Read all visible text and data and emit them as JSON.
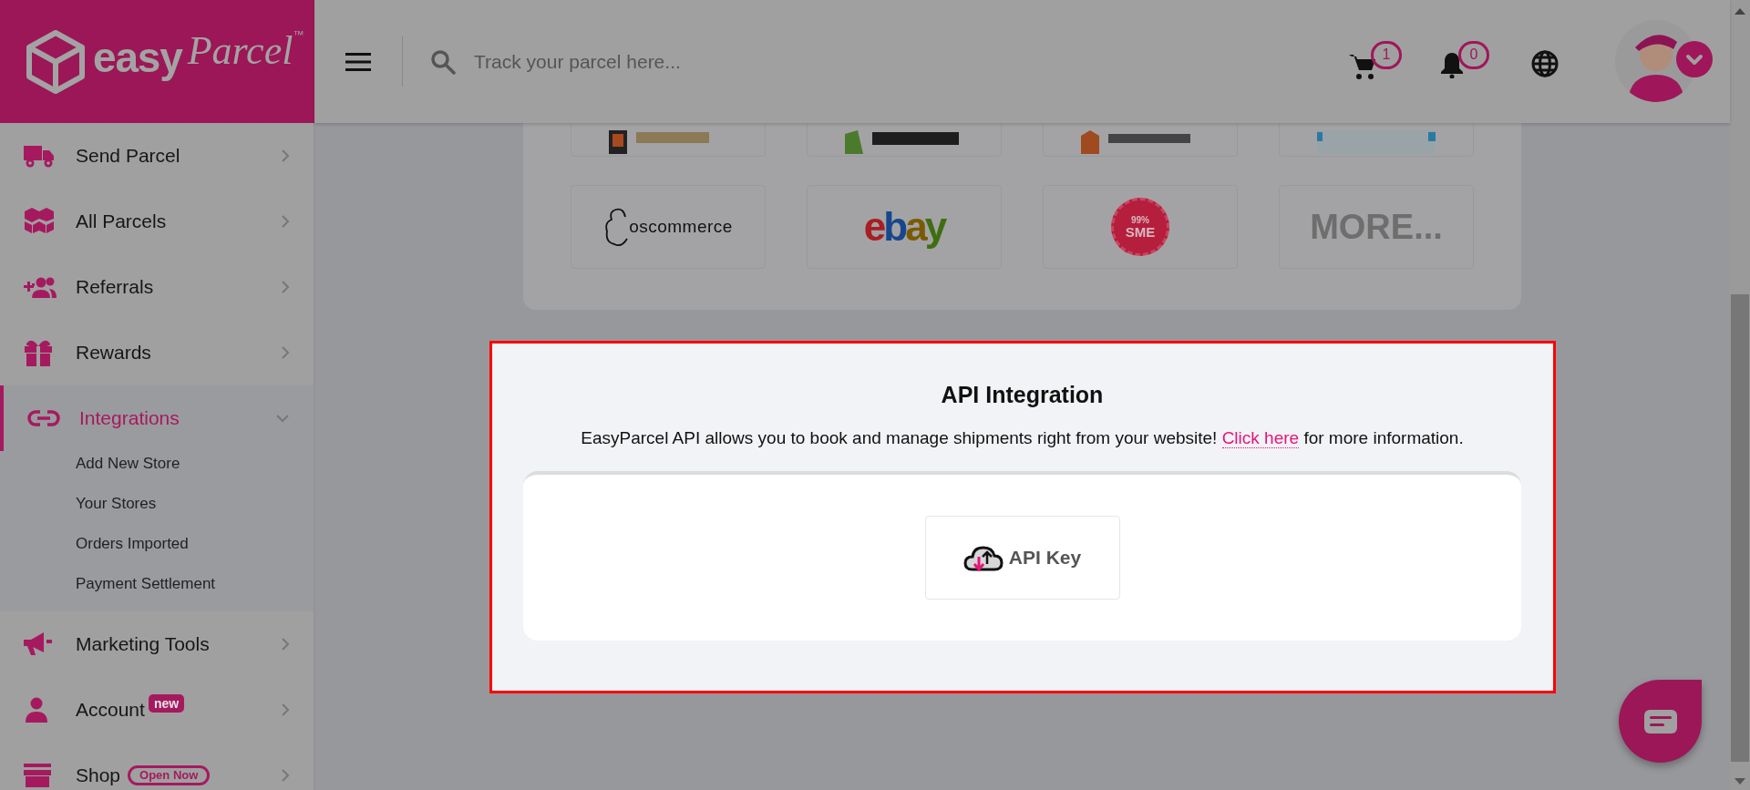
{
  "brand": {
    "name_bold": "easy",
    "name_script": "Parcel",
    "mark": "™"
  },
  "header": {
    "search": {
      "placeholder": "Track your parcel here..."
    },
    "cart_count": "1",
    "notification_count": "0"
  },
  "sidebar": {
    "items": [
      {
        "label": "Send Parcel",
        "selected": false,
        "expanded": false
      },
      {
        "label": "All Parcels",
        "selected": false,
        "expanded": false
      },
      {
        "label": "Referrals",
        "selected": false,
        "expanded": false
      },
      {
        "label": "Rewards",
        "selected": false,
        "expanded": false
      },
      {
        "label": "Integrations",
        "selected": true,
        "expanded": true,
        "children": [
          {
            "label": "Add New Store"
          },
          {
            "label": "Your Stores"
          },
          {
            "label": "Orders Imported"
          },
          {
            "label": "Payment Settlement"
          }
        ]
      },
      {
        "label": "Marketing Tools",
        "selected": false,
        "expanded": false
      },
      {
        "label": "Account",
        "selected": false,
        "expanded": false,
        "badge": {
          "text": "new",
          "kind": "filled"
        }
      },
      {
        "label": "Shop",
        "selected": false,
        "expanded": false,
        "badge": {
          "text": "Open Now",
          "kind": "outline"
        }
      }
    ]
  },
  "platform_tiles": [
    {
      "kind": "picture"
    },
    {
      "kind": "picture"
    },
    {
      "kind": "picture"
    },
    {
      "kind": "picture"
    },
    {
      "kind": "wordmark",
      "label": "oscommerce"
    },
    {
      "kind": "ebay",
      "label": "ebay"
    },
    {
      "kind": "seal",
      "lines": [
        "99%",
        "SME"
      ]
    },
    {
      "kind": "more",
      "label": "MORE..."
    }
  ],
  "api_card": {
    "title": "API Integration",
    "text_before": "EasyParcel API allows you to book and manage shipments right from your website!",
    "link": "Click here",
    "text_after": "for more information.",
    "button": {
      "label": "API Key"
    }
  }
}
